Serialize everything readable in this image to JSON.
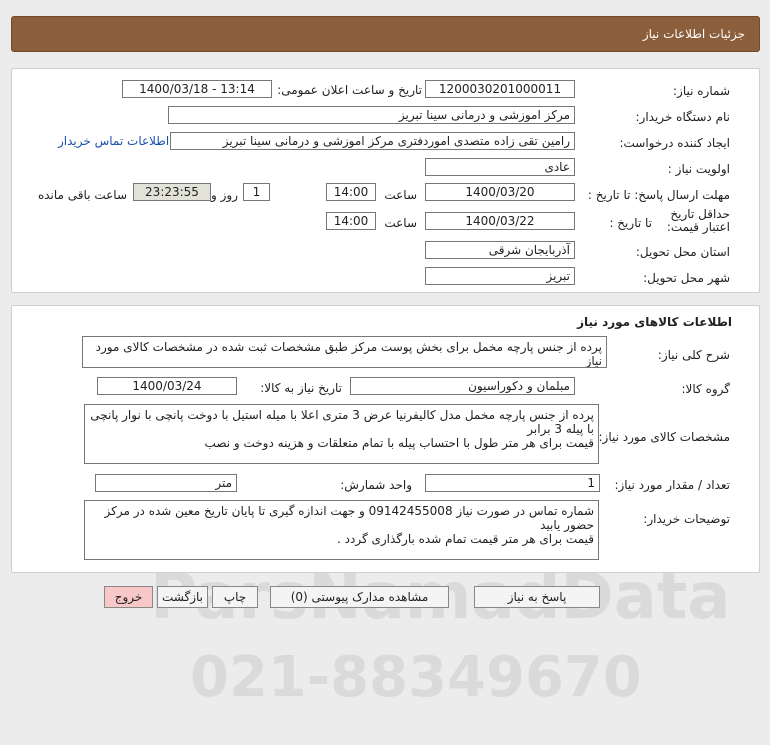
{
  "header": {
    "title": "جزئیات اطلاعات نیاز"
  },
  "info": {
    "need_number_label": "شماره نیاز:",
    "need_number": "1200030201000011",
    "announce_label": "تاریخ و ساعت اعلان عمومی:",
    "announce_value": "1400/03/18 - 13:14",
    "buyer_org_label": "نام دستگاه خریدار:",
    "buyer_org": "مرکز اموزشی و درمانی سینا تبریز",
    "creator_label": "ایجاد کننده درخواست:",
    "creator": "رامین تقی زاده متصدی اموردفتری مرکز اموزشی و درمانی سینا تبریز",
    "contact_link": "اطلاعات تماس خریدار",
    "priority_label": "اولویت نیاز :",
    "priority": "عادی",
    "deadline_label": "مهلت ارسال پاسخ: تا تاریخ :",
    "deadline_date": "1400/03/20",
    "time_label": "ساعت",
    "deadline_time": "14:00",
    "days_value": "1",
    "days_label": "روز و",
    "remaining_time": "23:23:55",
    "remaining_label": "ساعت باقی مانده",
    "validity_label": "حداقل تاریخ اعتبار قیمت:",
    "validity_to_label": "تا تاریخ :",
    "validity_date": "1400/03/22",
    "validity_time": "14:00",
    "province_label": "استان محل تحویل:",
    "province": "آذربایجان شرقی",
    "city_label": "شهر محل تحویل:",
    "city": "تبریز"
  },
  "goods": {
    "section_title": "اطلاعات کالاهای مورد نیاز",
    "summary_label": "شرح کلی نیاز:",
    "summary": "پرده از جنس پارچه مخمل برای بخش پوست مرکز طبق مشخصات ثبت شده در مشخصات کالای مورد نیاز",
    "group_label": "گروه کالا:",
    "group": "مبلمان و دکوراسیون",
    "need_date_label": "تاریخ نیاز به کالا:",
    "need_date": "1400/03/24",
    "specs_label": "مشخصات کالای مورد نیاز:",
    "specs": "پرده از جنس پارچه مخمل مدل کالیفرنیا عرض 3 متری اعلا با میله استیل با دوخت پانچی با نوار پانچی با پیله 3 برابر\nقیمت برای هر متر طول با احتساب پیله با تمام متعلقات و هزینه دوخت و نصب",
    "qty_label": "تعداد / مقدار مورد نیاز:",
    "qty": "1",
    "unit_label": "واحد شمارش:",
    "unit": "متر",
    "notes_label": "توضیحات خریدار:",
    "notes": "شماره تماس در صورت نیاز 09142455008 و جهت اندازه گیری تا پایان تاریخ معین شده در مرکز حضور یابید\nقیمت برای هر متر قیمت تمام شده بارگذاری گردد ."
  },
  "buttons": {
    "reply": "پاسخ به نیاز",
    "attachments": "مشاهده مدارک پیوستی (0)",
    "print": "چاپ",
    "back": "بازگشت",
    "exit": "خروج"
  },
  "watermark": {
    "main": "ParsNamadData",
    "phone": "021-88349670"
  }
}
